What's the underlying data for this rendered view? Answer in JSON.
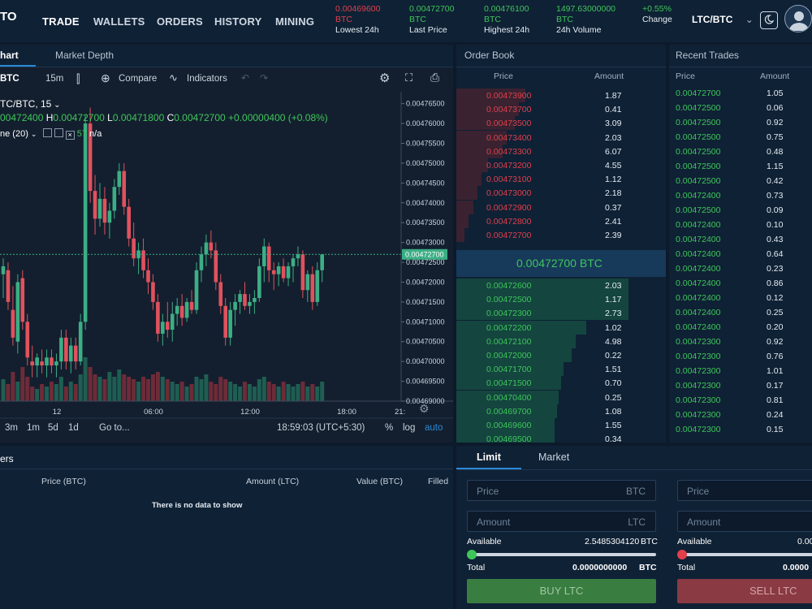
{
  "brand": {
    "logo_text": "TO"
  },
  "nav": {
    "trade": "TRADE",
    "wallets": "WALLETS",
    "orders": "ORDERS",
    "history": "HISTORY",
    "mining": "MINING"
  },
  "stats": {
    "lowest": {
      "value": "0.00469600",
      "unit": "BTC",
      "label": "Lowest 24h"
    },
    "last": {
      "value": "0.00472700",
      "unit": "BTC",
      "label": "Last Price"
    },
    "highest": {
      "value": "0.00476100",
      "unit": "BTC",
      "label": "Highest 24h"
    },
    "volume": {
      "value": "1497.63000000",
      "unit": "BTC",
      "label": "24h Volume"
    },
    "change": {
      "value": "+0.55%",
      "label": "Change"
    }
  },
  "pair_selector": {
    "value": "LTC/BTC"
  },
  "chart_panel": {
    "tab_chart": "hart",
    "tab_depth": "Market Depth",
    "toolbar": {
      "symbol": "BTC",
      "interval": "15m",
      "compare": "Compare",
      "indicators": "Indicators"
    },
    "legend": {
      "title": "TC/BTC, 15",
      "o": "00472400",
      "h_label": "H",
      "h": "0.00472700",
      "l_label": "L",
      "l": "0.00471800",
      "c_label": "C",
      "c": "0.00472700",
      "change": "+0.00000400 (+0.08%)",
      "volume_label": "ne (20)",
      "volume_value": "57",
      "volume_na": "n/a"
    },
    "bottom": {
      "ranges": [
        "3m",
        "1m",
        "5d",
        "1d"
      ],
      "goto": "Go to...",
      "time": "18:59:03 (UTC+5:30)",
      "pct": "%",
      "log": "log",
      "auto": "auto"
    },
    "colors": {
      "up": "#3cae85",
      "down": "#e0525e",
      "vol_up": "#1f5e52",
      "vol_down": "#6e2b38"
    }
  },
  "chart_data": {
    "type": "candlestick",
    "y_ticks": [
      "0.00476500",
      "0.00476000",
      "0.00475500",
      "0.00475000",
      "0.00474500",
      "0.00474000",
      "0.00473500",
      "0.00473000",
      "0.00472500",
      "0.00472000",
      "0.00471500",
      "0.00471000",
      "0.00470500",
      "0.00470000",
      "0.00469500",
      "0.00469000"
    ],
    "x_ticks": [
      "12",
      "06:00",
      "12:00",
      "18:00",
      "21:"
    ],
    "last_price": "0.00472700",
    "ylim": [
      0.00469,
      0.004768
    ],
    "candles": [
      [
        0.004722,
        0.004726,
        0.004716,
        0.004724
      ],
      [
        0.004723,
        0.004725,
        0.004713,
        0.004715
      ],
      [
        0.004713,
        0.004719,
        0.004704,
        0.004706
      ],
      [
        0.004705,
        0.004722,
        0.004702,
        0.00472
      ],
      [
        0.004721,
        0.004723,
        0.004708,
        0.00471
      ],
      [
        0.00471,
        0.004712,
        0.004699,
        0.004701
      ],
      [
        0.0047,
        0.004704,
        0.004696,
        0.004699
      ],
      [
        0.004699,
        0.004702,
        0.004696,
        0.004701
      ],
      [
        0.0047,
        0.004703,
        0.004697,
        0.004699
      ],
      [
        0.004699,
        0.004703,
        0.004696,
        0.004701
      ],
      [
        0.004701,
        0.004703,
        0.004697,
        0.004699
      ],
      [
        0.004699,
        0.004702,
        0.004696,
        0.0047
      ],
      [
        0.0047,
        0.004708,
        0.004698,
        0.004706
      ],
      [
        0.004706,
        0.004708,
        0.004698,
        0.0047
      ],
      [
        0.0047,
        0.004706,
        0.004697,
        0.004704
      ],
      [
        0.004704,
        0.004706,
        0.004698,
        0.0047
      ],
      [
        0.0047,
        0.004712,
        0.004699,
        0.00471
      ],
      [
        0.00471,
        0.004762,
        0.004708,
        0.00476
      ],
      [
        0.00476,
        0.004764,
        0.00474,
        0.004743
      ],
      [
        0.004743,
        0.004747,
        0.004732,
        0.004736
      ],
      [
        0.004736,
        0.004745,
        0.004734,
        0.004741
      ],
      [
        0.004741,
        0.004744,
        0.004732,
        0.004735
      ],
      [
        0.004735,
        0.00474,
        0.004731,
        0.004738
      ],
      [
        0.004738,
        0.004746,
        0.004736,
        0.004744
      ],
      [
        0.004744,
        0.00475,
        0.004742,
        0.004748
      ],
      [
        0.004748,
        0.00475,
        0.004737,
        0.004739
      ],
      [
        0.004739,
        0.004741,
        0.004729,
        0.004731
      ],
      [
        0.004731,
        0.004735,
        0.004724,
        0.004726
      ],
      [
        0.004726,
        0.00473,
        0.004722,
        0.004728
      ],
      [
        0.004728,
        0.004731,
        0.004721,
        0.004723
      ],
      [
        0.004723,
        0.004726,
        0.004717,
        0.00472
      ],
      [
        0.00472,
        0.004722,
        0.004713,
        0.004715
      ],
      [
        0.004715,
        0.004717,
        0.004705,
        0.004707
      ],
      [
        0.004707,
        0.004712,
        0.004704,
        0.00471
      ],
      [
        0.00471,
        0.004715,
        0.004706,
        0.004708
      ],
      [
        0.004708,
        0.004715,
        0.004705,
        0.004712
      ],
      [
        0.004712,
        0.004716,
        0.004709,
        0.004714
      ],
      [
        0.004714,
        0.004717,
        0.004709,
        0.004711
      ],
      [
        0.004711,
        0.004716,
        0.00471,
        0.004715
      ],
      [
        0.004715,
        0.004718,
        0.004712,
        0.004713
      ],
      [
        0.004713,
        0.004725,
        0.004712,
        0.004723
      ],
      [
        0.004723,
        0.004729,
        0.00472,
        0.004727
      ],
      [
        0.004727,
        0.004732,
        0.004724,
        0.00473
      ],
      [
        0.00473,
        0.004733,
        0.004726,
        0.004728
      ],
      [
        0.004728,
        0.00473,
        0.004718,
        0.00472
      ],
      [
        0.00472,
        0.004722,
        0.004712,
        0.004714
      ],
      [
        0.004714,
        0.004716,
        0.004704,
        0.004706
      ],
      [
        0.004706,
        0.004715,
        0.004704,
        0.004713
      ],
      [
        0.004713,
        0.004717,
        0.004709,
        0.004715
      ],
      [
        0.004715,
        0.004718,
        0.004712,
        0.004717
      ],
      [
        0.004717,
        0.00472,
        0.004713,
        0.004714
      ],
      [
        0.004714,
        0.004717,
        0.004712,
        0.004715
      ],
      [
        0.004715,
        0.004718,
        0.004712,
        0.004716
      ],
      [
        0.004716,
        0.004726,
        0.004715,
        0.004724
      ],
      [
        0.004724,
        0.004731,
        0.00472,
        0.004729
      ],
      [
        0.004729,
        0.00473,
        0.00472,
        0.004723
      ],
      [
        0.004723,
        0.004725,
        0.004718,
        0.004722
      ],
      [
        0.004722,
        0.004725,
        0.004719,
        0.004724
      ],
      [
        0.004724,
        0.004726,
        0.00472,
        0.004721
      ],
      [
        0.004721,
        0.004725,
        0.004719,
        0.004724
      ],
      [
        0.004724,
        0.004727,
        0.00472,
        0.004726
      ],
      [
        0.004726,
        0.004729,
        0.004724,
        0.004727
      ],
      [
        0.004727,
        0.004728,
        0.004716,
        0.004718
      ],
      [
        0.004718,
        0.004723,
        0.004715,
        0.004722
      ],
      [
        0.004722,
        0.004724,
        0.004713,
        0.004715
      ],
      [
        0.004715,
        0.004725,
        0.004714,
        0.004723
      ],
      [
        0.004723,
        0.004726,
        0.00472,
        0.004727
      ]
    ],
    "volumes": [
      0.45,
      0.35,
      0.6,
      0.4,
      0.7,
      0.5,
      0.3,
      0.25,
      0.35,
      0.3,
      0.4,
      0.35,
      0.5,
      0.3,
      0.4,
      0.35,
      0.55,
      0.9,
      0.7,
      0.55,
      0.5,
      0.45,
      0.6,
      0.5,
      0.65,
      0.55,
      0.5,
      0.45,
      0.4,
      0.5,
      0.45,
      0.55,
      0.6,
      0.5,
      0.45,
      0.4,
      0.35,
      0.4,
      0.3,
      0.35,
      0.5,
      0.45,
      0.55,
      0.4,
      0.35,
      0.5,
      0.45,
      0.4,
      0.35,
      0.3,
      0.4,
      0.35,
      0.3,
      0.45,
      0.5,
      0.4,
      0.35,
      0.3,
      0.4,
      0.35,
      0.3,
      0.35,
      0.4,
      0.3,
      0.35,
      0.3,
      0.4
    ]
  },
  "orderbook": {
    "title": "Order Book",
    "col_price": "Price",
    "col_amount": "Amount",
    "asks": [
      {
        "price": "0.00473900",
        "amount": "1.87",
        "depth": 0.33
      },
      {
        "price": "0.00473700",
        "amount": "0.41",
        "depth": 0.3
      },
      {
        "price": "0.00473500",
        "amount": "3.09",
        "depth": 0.28
      },
      {
        "price": "0.00473400",
        "amount": "2.03",
        "depth": 0.24
      },
      {
        "price": "0.00473300",
        "amount": "6.07",
        "depth": 0.22
      },
      {
        "price": "0.00473200",
        "amount": "4.55",
        "depth": 0.15
      },
      {
        "price": "0.00473100",
        "amount": "1.12",
        "depth": 0.12
      },
      {
        "price": "0.00473000",
        "amount": "2.18",
        "depth": 0.1
      },
      {
        "price": "0.00472900",
        "amount": "0.37",
        "depth": 0.08
      },
      {
        "price": "0.00472800",
        "amount": "2.41",
        "depth": 0.06
      },
      {
        "price": "0.00472700",
        "amount": "2.39",
        "depth": 0.04
      }
    ],
    "mid_price": "0.00472700 BTC",
    "bids": [
      {
        "price": "0.00472600",
        "amount": "2.03",
        "depth": 0.82
      },
      {
        "price": "0.00472500",
        "amount": "1.17",
        "depth": 0.82
      },
      {
        "price": "0.00472300",
        "amount": "2.73",
        "depth": 0.82
      },
      {
        "price": "0.00472200",
        "amount": "1.02",
        "depth": 0.62
      },
      {
        "price": "0.00472100",
        "amount": "4.98",
        "depth": 0.57
      },
      {
        "price": "0.00472000",
        "amount": "0.22",
        "depth": 0.55
      },
      {
        "price": "0.00471700",
        "amount": "1.51",
        "depth": 0.51
      },
      {
        "price": "0.00471500",
        "amount": "0.70",
        "depth": 0.5
      },
      {
        "price": "0.00470400",
        "amount": "0.25",
        "depth": 0.49
      },
      {
        "price": "0.00469700",
        "amount": "1.08",
        "depth": 0.48
      },
      {
        "price": "0.00469600",
        "amount": "1.55",
        "depth": 0.47
      },
      {
        "price": "0.00469500",
        "amount": "0.34",
        "depth": 0.47
      }
    ]
  },
  "recent_trades": {
    "title": "Recent Trades",
    "col_price": "Price",
    "col_amount": "Amount",
    "rows": [
      {
        "price": "0.00472700",
        "amount": "1.05"
      },
      {
        "price": "0.00472500",
        "amount": "0.06"
      },
      {
        "price": "0.00472500",
        "amount": "0.92"
      },
      {
        "price": "0.00472500",
        "amount": "0.75"
      },
      {
        "price": "0.00472500",
        "amount": "0.48"
      },
      {
        "price": "0.00472500",
        "amount": "1.15"
      },
      {
        "price": "0.00472500",
        "amount": "0.42"
      },
      {
        "price": "0.00472400",
        "amount": "0.73"
      },
      {
        "price": "0.00472500",
        "amount": "0.09"
      },
      {
        "price": "0.00472400",
        "amount": "0.10"
      },
      {
        "price": "0.00472400",
        "amount": "0.43"
      },
      {
        "price": "0.00472400",
        "amount": "0.64"
      },
      {
        "price": "0.00472400",
        "amount": "0.23"
      },
      {
        "price": "0.00472400",
        "amount": "0.86"
      },
      {
        "price": "0.00472400",
        "amount": "0.12"
      },
      {
        "price": "0.00472400",
        "amount": "0.25"
      },
      {
        "price": "0.00472400",
        "amount": "0.20"
      },
      {
        "price": "0.00472300",
        "amount": "0.92"
      },
      {
        "price": "0.00472300",
        "amount": "0.76"
      },
      {
        "price": "0.00472300",
        "amount": "1.01"
      },
      {
        "price": "0.00472300",
        "amount": "0.17"
      },
      {
        "price": "0.00472300",
        "amount": "0.81"
      },
      {
        "price": "0.00472300",
        "amount": "0.24"
      },
      {
        "price": "0.00472300",
        "amount": "0.15"
      }
    ]
  },
  "orders": {
    "title": "ers",
    "cols": {
      "price": "Price (BTC)",
      "amount": "Amount (LTC)",
      "value": "Value (BTC)",
      "filled": "Filled"
    },
    "empty": "There is no data to show"
  },
  "trade_form": {
    "tab_limit": "Limit",
    "tab_market": "Market",
    "buy": {
      "price_placeholder": "Price",
      "price_currency": "BTC",
      "amount_placeholder": "Amount",
      "amount_currency": "LTC",
      "available_label": "Available",
      "available_value": "2.5485304120",
      "available_currency": "BTC",
      "total_label": "Total",
      "total_value": "0.0000000000",
      "total_currency": "BTC",
      "button": "BUY LTC",
      "slider_pct": 0
    },
    "sell": {
      "price_placeholder": "Price",
      "amount_placeholder": "Amount",
      "available_label": "Available",
      "available_value": "0.00",
      "total_label": "Total",
      "total_value": "0.0000",
      "button": "SELL LTC",
      "slider_pct": 0
    }
  }
}
